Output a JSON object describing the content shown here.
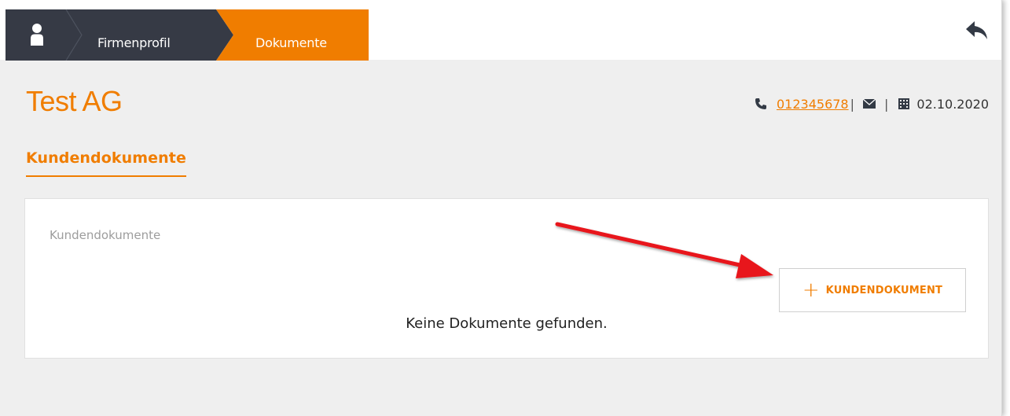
{
  "breadcrumb": {
    "items": [
      {
        "label": ""
      },
      {
        "label": "Firmenprofil"
      },
      {
        "label": "Dokumente"
      }
    ],
    "user_icon": "user-icon",
    "back_icon": "reply-icon"
  },
  "header": {
    "company_name": "Test AG",
    "phone": "012345678",
    "separator": "|",
    "date": "02.10.2020",
    "icons": [
      "phone-icon",
      "envelope-icon",
      "building-icon"
    ]
  },
  "section": {
    "tab_label": "Kundendokumente"
  },
  "card": {
    "title": "Kundendokumente",
    "add_button_plus": "+",
    "add_button_label": "KUNDENDOKUMENT",
    "empty_message": "Keine Dokumente gefunden."
  },
  "colors": {
    "accent": "#f07d00",
    "dark": "#363a45",
    "background": "#efefef",
    "arrow": "#e8161a"
  }
}
